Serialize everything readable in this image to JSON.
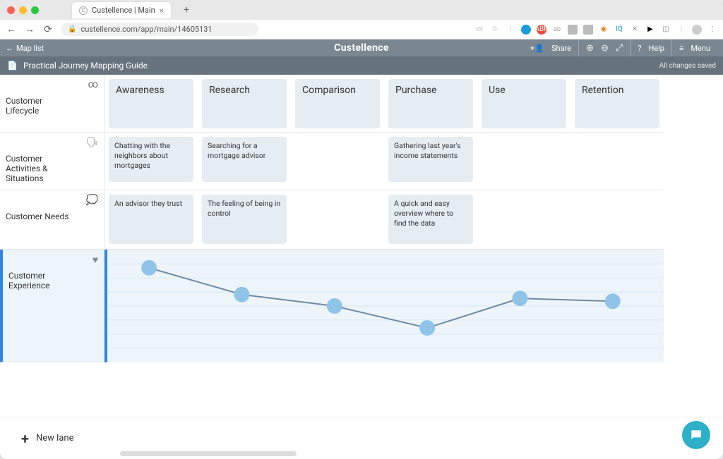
{
  "browser": {
    "tab_title": "Custellence | Main",
    "url": "custellence.com/app/main/14605131"
  },
  "app": {
    "back_label": "Map list",
    "logo": "Custellence",
    "share_label": "Share",
    "help_label": "Help",
    "menu_label": "Menu"
  },
  "doc": {
    "title": "Practical Journey Mapping Guide",
    "save_state": "All changes saved"
  },
  "phases": [
    "Awareness",
    "Research",
    "Comparison",
    "Purchase",
    "Use",
    "Retention"
  ],
  "lanes": {
    "lifecycle": {
      "label": "Customer Lifecycle",
      "icon": "∞"
    },
    "activities": {
      "label": "Customer Activities & Situations",
      "icon": "🗣"
    },
    "needs": {
      "label": "Customer Needs",
      "icon": "💭"
    },
    "experience": {
      "label": "Customer Experience",
      "icon": "♥"
    }
  },
  "cards": {
    "activities": [
      "Chatting with the neighbors about mortgages",
      "Searching for a mortgage advisor",
      "",
      "Gathering last year's income statements",
      "",
      ""
    ],
    "needs": [
      "An advisor they trust",
      "The feeling of being in control",
      "",
      "A quick and easy overview where to find the data",
      "",
      ""
    ]
  },
  "new_lane_label": "New lane",
  "chart_data": {
    "type": "line",
    "title": "Customer Experience",
    "categories": [
      "Awareness",
      "Research",
      "Comparison",
      "Purchase",
      "Use",
      "Retention"
    ],
    "values": [
      90,
      62,
      50,
      27,
      58,
      55
    ],
    "ylim": [
      0,
      100
    ],
    "note": "values are relative emotional-experience scores estimated from dot vertical positions; higher = more positive"
  }
}
